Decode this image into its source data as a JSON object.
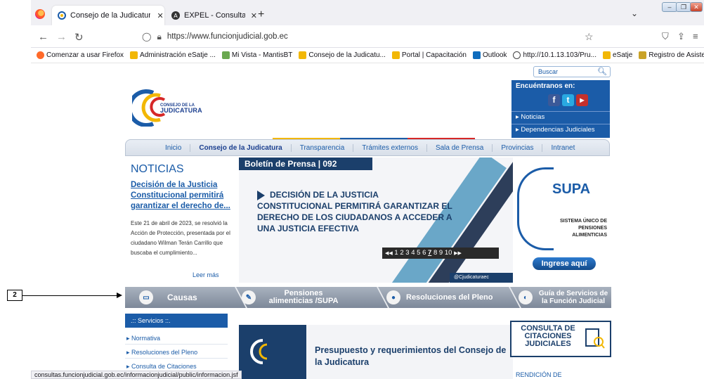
{
  "browser": {
    "tabs": [
      {
        "title": "Consejo de la Judicatura | Cons",
        "close": "✕"
      },
      {
        "title": "EXPEL - Consulta de procesos",
        "close": "✕"
      }
    ],
    "new_tab": "+",
    "list_all": "⌄",
    "url": "https://www.funcionjudicial.gob.ec",
    "bookmarks": [
      "Comenzar a usar Firefox",
      "Administración eSatje ...",
      "Mi Vista - MantisBT",
      "Consejo de la Judicatu...",
      "Portal | Capacitación",
      "Outlook",
      "http://10.1.13.103/Pru...",
      "eSatje",
      "Registro de Asistencia ..."
    ],
    "status_url": "consultas.funcionjudicial.gob.ec/informacionjudicial/public/informacion.jsf"
  },
  "page": {
    "search_placeholder": "Buscar",
    "logo_line1": "CONSEJO DE LA",
    "logo_line2": "JUDICATURA",
    "findus": {
      "header": "Encuéntranos en:",
      "links": [
        "▸ Noticias",
        "▸ Dependencias Judiciales"
      ]
    },
    "menu": [
      "Inicio",
      "Consejo de la Judicatura",
      "Transparencia",
      "Trámites externos",
      "Sala de Prensa",
      "Provincias",
      "Intranet"
    ],
    "news": {
      "heading": "NOTICIAS",
      "title": "Decisión de la Justicia Constitucional permitirá garantizar el derecho de...",
      "body": "Este 21 de abril de 2023, se resolvió la Acción de Protección, presentada por el ciudadano Wilman Terán Carrillo que buscaba el cumplimiento...",
      "more": "Leer más"
    },
    "slider": {
      "band": "Boletín de Prensa | 092",
      "headline": "DECISIÓN DE LA JUSTICIA CONSTITUCIONAL PERMITIRÁ GARANTIZAR EL DERECHO DE LOS CIUDADANOS A ACCEDER A UNA JUSTICIA EFECTIVA",
      "pager_prev": "◀◀",
      "pager_next": "▶▶",
      "pages": [
        "1",
        "2",
        "3",
        "4",
        "5",
        "6",
        "7",
        "8",
        "9",
        "10"
      ],
      "current_page": "7",
      "footer": "@Cjudicaturaec"
    },
    "supa": {
      "name": "SUPA",
      "subtitle": "SISTEMA ÚNICO DE PENSIONES ALIMENTICIAS",
      "button": "Ingrese aquí"
    },
    "callout": "2",
    "ribbon": [
      "Causas",
      "Pensiones alimenticias /SUPA",
      "Resoluciones del Pleno",
      "Guía de Servicios de la Función Judicial"
    ],
    "services": {
      "header": ".:: Servicios ::.",
      "items": [
        "▸ Normativa",
        "▸ Resoluciones del Pleno",
        "▸ Consulta de Citaciones"
      ]
    },
    "budget": "Presupuesto y requerimientos del Consejo de la Judicatura",
    "consulta": "CONSULTA DE CITACIONES JUDICIALES",
    "rendicion": "RENDICIÓN DE"
  },
  "colors": {
    "brand_blue": "#1b5ca8",
    "navy": "#1b3f6b",
    "ribbon_gray": "#8e98a6"
  }
}
